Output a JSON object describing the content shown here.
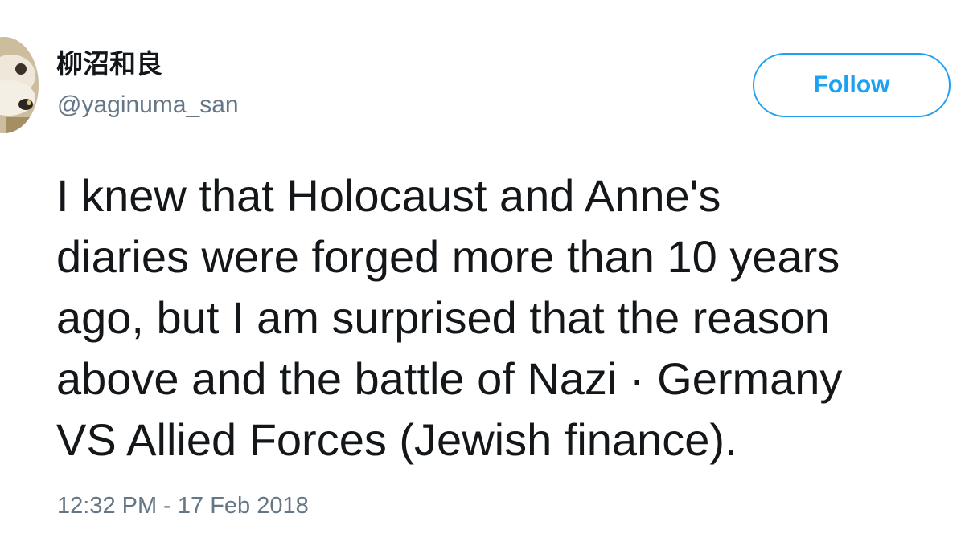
{
  "tweet": {
    "author": {
      "display_name": "柳沼和良",
      "handle": "@yaginuma_san",
      "avatar_icon": "avatar-photo"
    },
    "follow_label": "Follow",
    "text_lines": [
      "I knew that Holocaust and Anne's",
      "diaries were forged more than 10 years",
      "ago, but I am surprised that the reason",
      "above and the battle of Nazi · Germany",
      "VS Allied Forces (Jewish finance)."
    ],
    "timestamp": "12:32 PM - 17 Feb 2018"
  },
  "colors": {
    "accent": "#1da1f2",
    "text": "#14171a",
    "secondary_text": "#657786"
  }
}
